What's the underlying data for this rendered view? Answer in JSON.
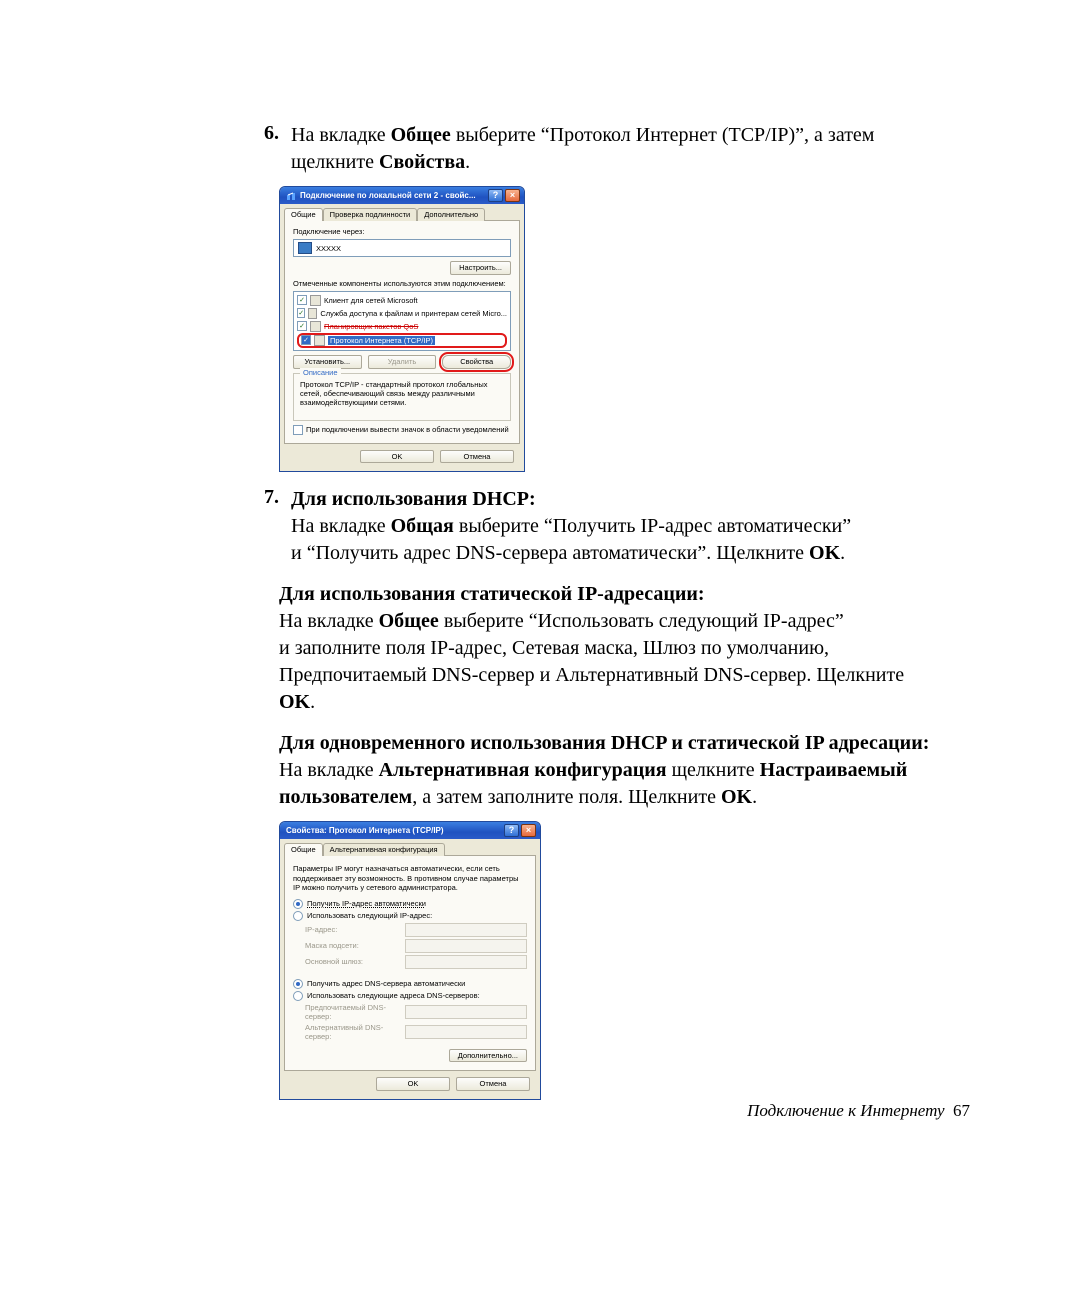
{
  "step6": {
    "num": "6.",
    "line1_a": "На вкладке ",
    "line1_b": "Общее",
    "line1_c": " выберите “Протокол Интернет (TCP/IP)”, а затем",
    "line2_a": "щелкните ",
    "line2_b": "Свойства",
    "line2_c": "."
  },
  "dialog1": {
    "title": "Подключение по локальной сети 2 - свойс...",
    "tabs": [
      "Общие",
      "Проверка подлинности",
      "Дополнительно"
    ],
    "connect_using": "Подключение через:",
    "adapter": "XXXXX",
    "configure": "Настроить...",
    "components_text": "Отмеченные компоненты используются этим подключением:",
    "components": [
      "Клиент для сетей Microsoft",
      "Служба доступа к файлам и принтерам сетей Micro...",
      "Планировщик пакетов QoS",
      "Протокол Интернета (TCP/IP)"
    ],
    "install": "Установить...",
    "remove": "Удалить",
    "properties": "Свойства",
    "description_label": "Описание",
    "description": "Протокол TCP/IP - стандартный протокол глобальных сетей, обеспечивающий связь между различными взаимодействующими сетями.",
    "show_icon": "При подключении вывести значок в области уведомлений",
    "ok": "OK",
    "cancel": "Отмена"
  },
  "step7": {
    "num": "7.",
    "heading": "Для использования DHCP:",
    "p1_a": "На вкладке ",
    "p1_b": "Общая",
    "p1_c": " выберите “Получить IP-адрес автоматически”",
    "p2": "и “Получить адрес DNS-сервера автоматически”. Щелкните ",
    "p2_b": "OK",
    "p2_c": "."
  },
  "static": {
    "heading": "Для использования статической IP-адресации:",
    "p1_a": "На вкладке ",
    "p1_b": "Общее",
    "p1_c": " выберите “Использовать следующий IP-адрес”",
    "p2": "и заполните поля IP-адрес, Сетевая маска, Шлюз по умолчанию,",
    "p3_a": "Предпочитаемый DNS-сервер и Альтернативный DNS-сервер. Щелкните",
    "p4": "OK",
    "p4_c": "."
  },
  "both": {
    "heading": "Для одновременного использования DHCP и статической IP адресации:",
    "p1_a": "На вкладке ",
    "p1_b": "Альтернативная конфигурация",
    "p1_c": " щелкните ",
    "p1_d": "Настраиваемый",
    "p2_a": "пользователем",
    "p2_b": ", а затем заполните поля. Щелкните ",
    "p2_c": "OK",
    "p2_d": "."
  },
  "dialog2": {
    "title": "Свойства: Протокол Интернета (TCP/IP)",
    "tabs": [
      "Общие",
      "Альтернативная конфигурация"
    ],
    "desc": "Параметры IP могут назначаться автоматически, если сеть поддерживает эту возможность. В противном случае параметры IP можно получить у сетевого администратора.",
    "radio_ip_auto": "Получить IP-адрес автоматически",
    "radio_ip_manual": "Использовать следующий IP-адрес:",
    "ip_address": "IP-адрес:",
    "subnet": "Маска подсети:",
    "gateway": "Основной шлюз:",
    "radio_dns_auto": "Получить адрес DNS-сервера автоматически",
    "radio_dns_manual": "Использовать следующие адреса DNS-серверов:",
    "dns1": "Предпочитаемый DNS-сервер:",
    "dns2": "Альтернативный DNS-сервер:",
    "advanced": "Дополнительно...",
    "ok": "OK",
    "cancel": "Отмена"
  },
  "footer": {
    "text": "Подключение к Интернету",
    "page": "67"
  }
}
